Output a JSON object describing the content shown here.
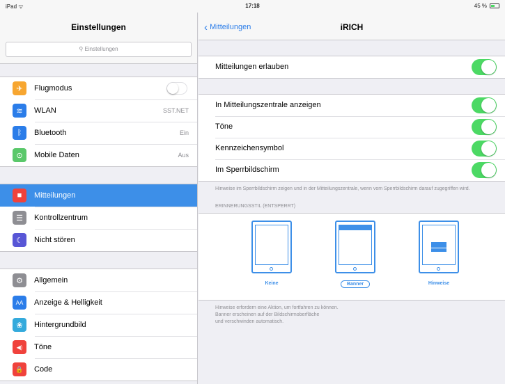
{
  "status": {
    "left": "iPad ᯤ",
    "time": "17:18",
    "battery": "45 %"
  },
  "left": {
    "title": "Einstellungen",
    "search_placeholder": "Einstellungen",
    "group1": [
      {
        "label": "Flugmodus",
        "icon": "airplane-icon",
        "color": "#f7a630",
        "glyph": "✈"
      },
      {
        "label": "WLAN",
        "value": "SST.NET",
        "icon": "wifi-icon",
        "color": "#2b7de9",
        "glyph": "≋"
      },
      {
        "label": "Bluetooth",
        "value": "Ein",
        "icon": "bluetooth-icon",
        "color": "#2b7de9",
        "glyph": "ᛒ"
      },
      {
        "label": "Mobile Daten",
        "value": "Aus",
        "icon": "antenna-icon",
        "color": "#5ac86a",
        "glyph": "⊙"
      }
    ],
    "group2": [
      {
        "label": "Mitteilungen",
        "icon": "notifications-icon",
        "color": "#f0423c",
        "glyph": "■"
      },
      {
        "label": "Kontrollzentrum",
        "icon": "control-center-icon",
        "color": "#8e8e93",
        "glyph": "☰"
      },
      {
        "label": "Nicht stören",
        "icon": "moon-icon",
        "color": "#5856d6",
        "glyph": "☾"
      }
    ],
    "group3": [
      {
        "label": "Allgemein",
        "icon": "gear-icon",
        "color": "#8e8e93",
        "glyph": "⚙"
      },
      {
        "label": "Anzeige & Helligkeit",
        "icon": "brightness-icon",
        "color": "#2b7de9",
        "glyph": "AA"
      },
      {
        "label": "Hintergrundbild",
        "icon": "wallpaper-icon",
        "color": "#34aadc",
        "glyph": "❀"
      },
      {
        "label": "Töne",
        "icon": "sound-icon",
        "color": "#f0423c",
        "glyph": "◀)"
      },
      {
        "label": "Code",
        "icon": "lock-icon",
        "color": "#f0423c",
        "glyph": "🔒"
      }
    ]
  },
  "right": {
    "back_label": "Mitteilungen",
    "title": "iRICH",
    "allow_label": "Mitteilungen erlauben",
    "options": [
      "In Mitteilungszentrale anzeigen",
      "Töne",
      "Kennzeichensymbol",
      "Im Sperrbildschirm"
    ],
    "lock_note": "Hinweise im Sperrbildschirm zeigen und in der Mitteilungszentrale, wenn vom Sperrbildschirm darauf zugegriffen wird.",
    "alert_style_header": "ERINNERUNGSSTIL (ENTSPERRT)",
    "styles": {
      "none": "Keine",
      "banner": "Banner",
      "alerts": "Hinweise"
    },
    "style_note": [
      "Hinweise erfordern eine Aktion, um fortfahren zu können.",
      "Banner erscheinen auf der Bildschirmoberfläche",
      "und verschwinden automatisch."
    ]
  },
  "colors": {
    "accent": "#3d8fe8",
    "toggle_on": "#4cd964"
  }
}
